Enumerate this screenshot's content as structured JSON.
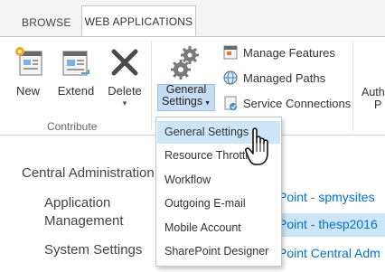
{
  "tabs": {
    "browse": "BROWSE",
    "web_applications": "WEB APPLICATIONS"
  },
  "ribbon": {
    "new": "New",
    "extend": "Extend",
    "delete": "Delete",
    "contribute_group": "Contribute",
    "general_settings_line1": "General",
    "general_settings_line2": "Settings",
    "manage_features": "Manage Features",
    "managed_paths": "Managed Paths",
    "service_connections": "Service Connections",
    "auth_partial_1": "Auth",
    "auth_partial_2": "P"
  },
  "main": {
    "central_admin": "Central Administration",
    "app_management_1": "Application",
    "app_management_2": "Management",
    "system_settings": "System Settings",
    "link1": "Point - spmysites",
    "link2": "Point - thesp2016",
    "link3": "Point Central Adm"
  },
  "menu": {
    "items": [
      "General Settings",
      "Resource Throttling",
      "Workflow",
      "Outgoing E-mail",
      "Mobile Account",
      "SharePoint Designer"
    ]
  }
}
